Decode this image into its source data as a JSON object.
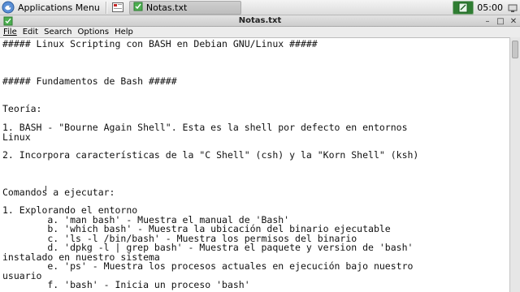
{
  "panel": {
    "apps_menu_label": "Applications Menu",
    "task_label": "Notas.txt",
    "clock": "05:00"
  },
  "window": {
    "title": "Notas.txt"
  },
  "menu": [
    "File",
    "Edit",
    "Search",
    "Options",
    "Help"
  ],
  "editor": {
    "lines": [
      "##### Linux Scripting con BASH en Debian GNU/Linux #####",
      "",
      "",
      "",
      "##### Fundamentos de Bash #####",
      "",
      "",
      "Teoría:",
      "",
      "1. BASH - \"Bourne Again Shell\". Esta es la shell por defecto en entornos",
      "Linux",
      "",
      "2. Incorpora características de la \"C Shell\" (csh) y la \"Korn Shell\" (ksh)",
      "",
      "",
      "",
      "Comandos a ejecutar:",
      "",
      "1. Explorando el entorno",
      "\ta. 'man bash' - Muestra el manual de 'Bash'",
      "\tb. 'which bash' - Muestra la ubicación del binario ejecutable",
      "\tc. 'ls -l /bin/bash' - Muestra los permisos del binario",
      "\td. 'dpkg -l | grep bash' - Muestra el paquete y version de 'bash'",
      "instalado en nuestro sistema",
      "\te. 'ps' - Muestra los procesos actuales en ejecución bajo nuestro",
      "usuario",
      "\tf. 'bash' - Inicia un proceso 'bash'"
    ]
  },
  "colors": {
    "panel_bg": "#e4e4e4",
    "tray_green": "#2f7d32",
    "editor_bg": "#ffffff"
  }
}
